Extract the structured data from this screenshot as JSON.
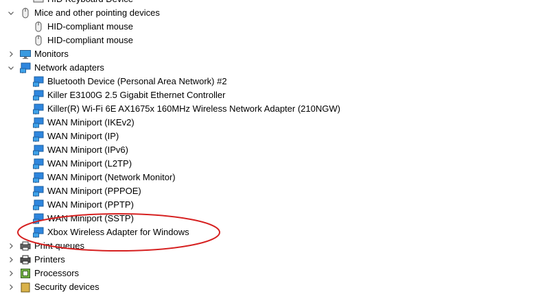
{
  "tree": {
    "top_partial": "HID Keyboard Device",
    "mice": {
      "label": "Mice and other pointing devices",
      "children": [
        "HID-compliant mouse",
        "HID-compliant mouse"
      ]
    },
    "monitors": {
      "label": "Monitors"
    },
    "network": {
      "label": "Network adapters",
      "children": [
        "Bluetooth Device (Personal Area Network) #2",
        "Killer E3100G 2.5 Gigabit Ethernet Controller",
        "Killer(R) Wi-Fi 6E AX1675x 160MHz Wireless Network Adapter (210NGW)",
        "WAN Miniport (IKEv2)",
        "WAN Miniport (IP)",
        "WAN Miniport (IPv6)",
        "WAN Miniport (L2TP)",
        "WAN Miniport (Network Monitor)",
        "WAN Miniport (PPPOE)",
        "WAN Miniport (PPTP)",
        "WAN Miniport (SSTP)",
        "Xbox Wireless Adapter for Windows"
      ]
    },
    "print_queues": {
      "label": "Print queues"
    },
    "printers": {
      "label": "Printers"
    },
    "processors": {
      "label": "Processors"
    },
    "security": {
      "label": "Security devices"
    }
  },
  "colors": {
    "highlight_ellipse": "#d62020",
    "network_icon_blue": "#2e86de",
    "chevron": "#555555"
  }
}
